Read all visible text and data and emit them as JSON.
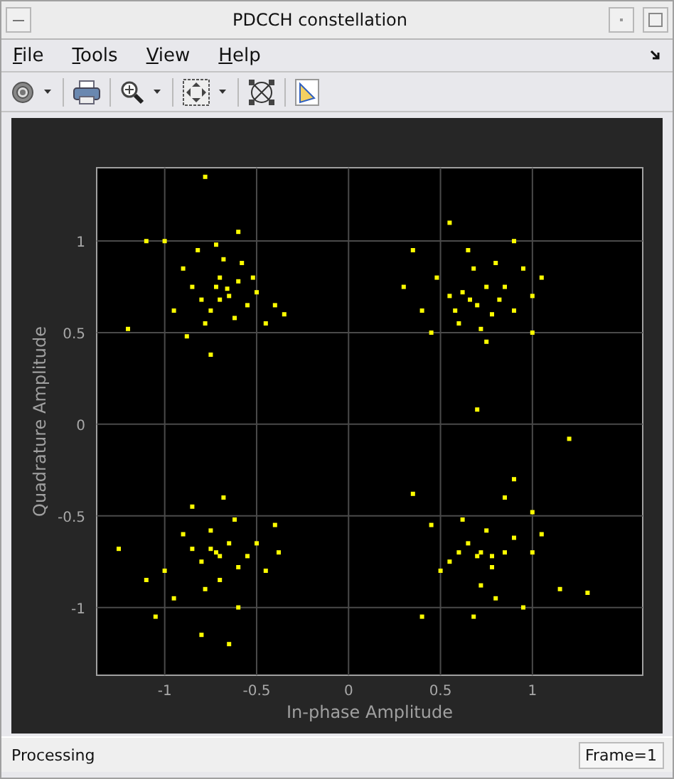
{
  "window": {
    "title": "PDCCH constellation"
  },
  "menu": [
    {
      "label": "File"
    },
    {
      "label": "Tools"
    },
    {
      "label": "View"
    },
    {
      "label": "Help"
    }
  ],
  "toolbar": [
    {
      "kind": "gear",
      "dropdown": true
    },
    {
      "kind": "print",
      "dropdown": false
    },
    {
      "kind": "zoom",
      "dropdown": true
    },
    {
      "kind": "fit",
      "dropdown": true
    },
    {
      "kind": "constellation",
      "dropdown": false
    },
    {
      "kind": "properties",
      "dropdown": false
    }
  ],
  "plot": {
    "chart_data": {
      "type": "scatter",
      "xlabel": "In-phase Amplitude",
      "ylabel": "Quadrature Amplitude",
      "xlim": [
        -1.37,
        1.6
      ],
      "ylim": [
        -1.37,
        1.4
      ],
      "xticks": [
        -1,
        -0.5,
        0,
        0.5,
        1
      ],
      "yticks": [
        -1,
        -0.5,
        0,
        0.5,
        1
      ],
      "grid": true,
      "series": [
        {
          "color": "#ffff00",
          "x": [
            -0.72,
            -0.65,
            -0.8,
            -0.7,
            -0.6,
            -0.75,
            -0.85,
            -0.55,
            -0.68,
            -0.9,
            -0.5,
            -0.78,
            -0.62,
            -0.95,
            -0.4,
            -0.72,
            -1.0,
            -1.1,
            -1.2,
            -0.82,
            -0.58,
            -0.45,
            -0.35,
            -0.75,
            -0.6,
            -0.78,
            -0.88,
            -0.52,
            -0.7,
            -0.66,
            0.7,
            0.62,
            0.78,
            0.55,
            0.85,
            0.68,
            0.72,
            0.6,
            0.9,
            0.48,
            0.8,
            0.65,
            0.4,
            1.0,
            0.35,
            0.95,
            1.05,
            0.75,
            0.55,
            0.7,
            0.9,
            0.45,
            0.82,
            0.58,
            1.0,
            0.3,
            0.75,
            0.66,
            -0.72,
            -0.65,
            -0.8,
            -0.6,
            -0.75,
            -0.85,
            -0.55,
            -0.7,
            -0.9,
            -0.62,
            -0.5,
            -0.78,
            -1.0,
            -1.05,
            -1.25,
            -0.68,
            -0.45,
            -0.38,
            -0.95,
            -0.6,
            -0.8,
            -0.65,
            -0.4,
            -0.85,
            -1.1,
            -0.7,
            -0.75,
            0.7,
            0.65,
            0.78,
            0.6,
            0.75,
            0.85,
            0.55,
            0.72,
            0.9,
            0.62,
            0.5,
            0.8,
            1.0,
            0.95,
            0.35,
            0.85,
            1.05,
            1.15,
            1.3,
            0.68,
            0.4,
            0.9,
            1.0,
            1.2,
            0.45,
            0.72,
            0.78
          ],
          "values": [
            0.75,
            0.7,
            0.68,
            0.8,
            0.78,
            0.62,
            0.75,
            0.65,
            0.9,
            0.85,
            0.72,
            0.55,
            0.58,
            0.62,
            0.65,
            0.98,
            1.0,
            1.0,
            0.52,
            0.95,
            0.88,
            0.55,
            0.6,
            0.38,
            1.05,
            1.35,
            0.48,
            0.8,
            0.68,
            0.74,
            0.65,
            0.72,
            0.6,
            0.7,
            0.75,
            0.85,
            0.52,
            0.55,
            0.62,
            0.8,
            0.88,
            0.95,
            0.62,
            0.7,
            0.95,
            0.85,
            0.8,
            0.45,
            1.1,
            0.08,
            1.0,
            0.5,
            0.68,
            0.62,
            0.5,
            0.75,
            0.75,
            0.68,
            -0.7,
            -0.65,
            -0.75,
            -0.78,
            -0.58,
            -0.68,
            -0.72,
            -0.85,
            -0.6,
            -0.52,
            -0.65,
            -0.9,
            -0.8,
            -1.05,
            -0.68,
            -0.4,
            -0.8,
            -0.7,
            -0.95,
            -1.0,
            -1.15,
            -1.2,
            -0.55,
            -0.45,
            -0.85,
            -0.72,
            -0.68,
            -0.72,
            -0.65,
            -0.78,
            -0.7,
            -0.58,
            -0.7,
            -0.75,
            -0.88,
            -0.62,
            -0.52,
            -0.8,
            -0.95,
            -0.7,
            -1.0,
            -0.38,
            -0.4,
            -0.6,
            -0.9,
            -0.92,
            -1.05,
            -1.05,
            -0.3,
            -0.48,
            -0.08,
            -0.55,
            -0.7,
            -0.72
          ]
        }
      ]
    }
  },
  "status_bar": {
    "message": "Processing",
    "frame": "Frame=1"
  }
}
